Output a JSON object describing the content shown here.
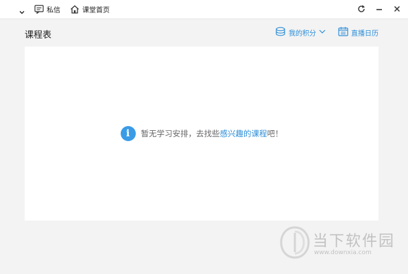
{
  "titlebar": {
    "messages_label": "私信",
    "home_label": "课堂首页"
  },
  "header": {
    "title": "课程表",
    "points_label": "我的积分",
    "calendar_label": "直播日历"
  },
  "empty_state": {
    "text_before": "暂无学习安排，去找些",
    "link_text": "感兴趣的课程",
    "text_after": "吧！"
  },
  "watermark": {
    "name": "当下软件园",
    "url": "www.downxia.com"
  },
  "colors": {
    "accent": "#2d8ed8",
    "info_icon": "#3a9be6",
    "background": "#f3f3f3",
    "panel": "#ffffff"
  }
}
